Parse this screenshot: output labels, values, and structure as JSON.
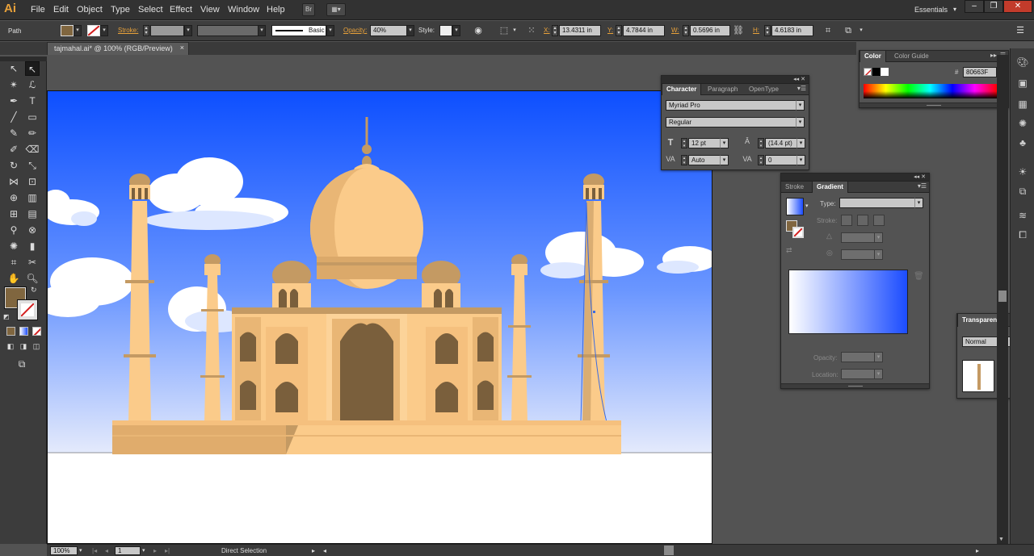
{
  "app": {
    "logo": "Ai"
  },
  "menu": {
    "items": [
      "File",
      "Edit",
      "Object",
      "Type",
      "Select",
      "Effect",
      "View",
      "Window",
      "Help"
    ],
    "bridge_label": "Br",
    "workspace": "Essentials"
  },
  "control_bar": {
    "selection_type": "Path",
    "stroke_label": "Stroke:",
    "brush_label": "Basic",
    "opacity_label": "Opacity:",
    "opacity_value": "40%",
    "style_label": "Style:",
    "x_label": "X:",
    "x_value": "13.4311 in",
    "y_label": "Y:",
    "y_value": "4.7844 in",
    "w_label": "W:",
    "w_value": "0.5696 in",
    "h_label": "H:",
    "h_value": "4.6183 in"
  },
  "document": {
    "tab_title": "tajmahal.ai* @ 100% (RGB/Preview)",
    "close_glyph": "×"
  },
  "colors": {
    "fill": "#80663f",
    "sky_top": "#0d4fff",
    "sky_bottom": "#e4eafc",
    "building": "#fbcb8a",
    "building_dark": "#c49a63",
    "door": "#7a5f3c"
  },
  "character_panel": {
    "tabs": [
      "Character",
      "Paragraph",
      "OpenType"
    ],
    "font_family": "Myriad Pro",
    "font_style": "Regular",
    "font_size": "12 pt",
    "leading": "(14.4 pt)",
    "kerning": "Auto",
    "tracking": "0"
  },
  "color_panel": {
    "tabs": [
      "Color",
      "Color Guide"
    ],
    "hex_prefix": "#",
    "hex_value": "80663F"
  },
  "gradient_panel": {
    "tabs": [
      "Stroke",
      "Gradient"
    ],
    "type_label": "Type:",
    "stroke_label": "Stroke:",
    "opacity_label": "Opacity:",
    "location_label": "Location:"
  },
  "transparency_panel": {
    "title": "Transparency",
    "blend_mode": "Normal"
  },
  "status_bar": {
    "zoom": "100%",
    "artboard": "1",
    "tool": "Direct Selection"
  }
}
